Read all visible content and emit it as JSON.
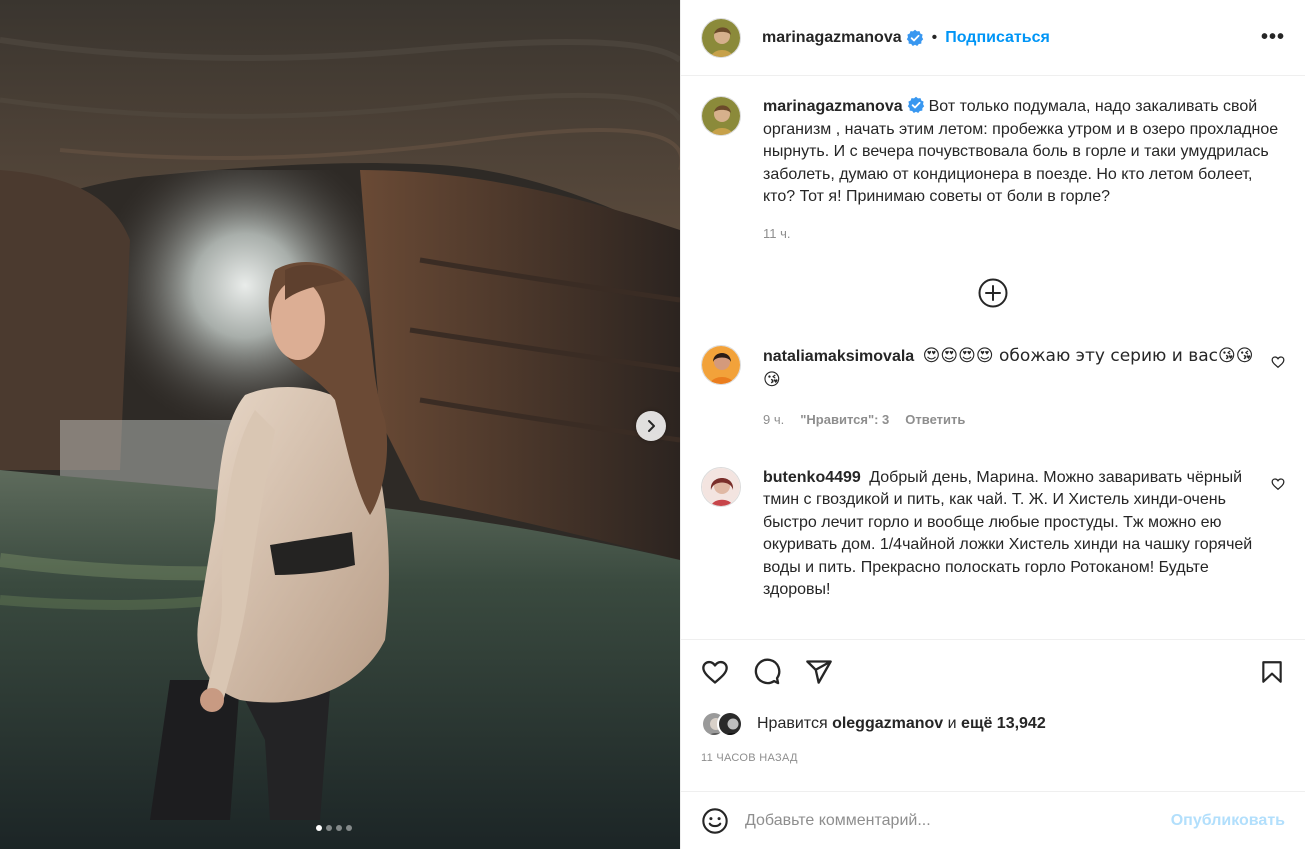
{
  "header": {
    "username": "marinagazmanova",
    "bullet": "•",
    "follow_label": "Подписаться",
    "more_label": "•••"
  },
  "caption": {
    "username": "marinagazmanova",
    "text": "Вот только подумала, надо закаливать свой организм , начать этим летом: пробежка утром и в озеро прохладное нырнуть. И с вечера почувствовала боль в горле и таки умудрилась заболеть, думаю от кондиционера в поезде. Но кто летом болеет, кто? Тот я! Принимаю советы от боли в горле?",
    "time": "11 ч."
  },
  "comments": [
    {
      "username": "nataliamaksimovala",
      "text": "😍😍😍😍 обожаю эту серию и вас😘😘😘",
      "time": "9 ч.",
      "likes": "\"Нравится\": 3",
      "reply": "Ответить"
    },
    {
      "username": "butenko4499",
      "text": "Добрый день, Марина. Можно заваривать чёрный тмин с гвоздикой и пить, как чай. Т. Ж. И Хистель хинди-очень быстро лечит горло и вообще любые простуды. Тж можно ею окуривать дом. 1/4чайной ложки Хистель хинди на чашку горячей воды и пить. Прекрасно полоскать горло Ротоканом! Будьте здоровы!"
    }
  ],
  "likes": {
    "prefix": "Нравится",
    "user": "oleggazmanov",
    "middle": "и",
    "rest": "ещё 13,942"
  },
  "posted": "11 часов назад",
  "add_comment": {
    "placeholder": "Добавьте комментарий...",
    "publish_label": "Опубликовать"
  },
  "carousel": {
    "slides": 4,
    "active": 1
  },
  "colors": {
    "accent": "#0095f6",
    "publish_disabled": "#b2dffc",
    "muted": "#8e8e8e",
    "verified": "#3897f0"
  }
}
